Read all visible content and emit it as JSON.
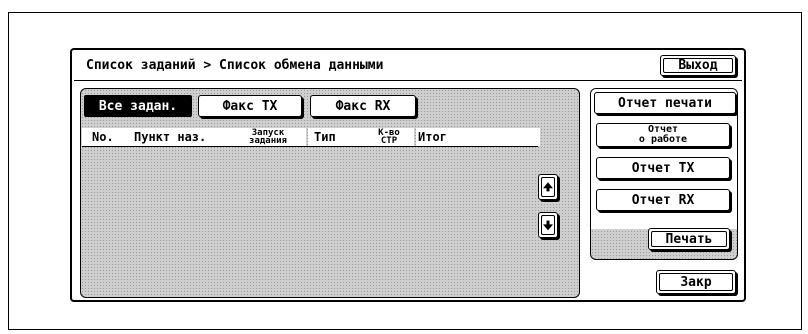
{
  "header": {
    "title": "Список заданий > Список обмена данными",
    "exit_label": "Выход"
  },
  "filter_tabs": [
    {
      "label": "Все задан.",
      "selected": true
    },
    {
      "label": "Факс TX",
      "selected": false
    },
    {
      "label": "Факс RX",
      "selected": false
    }
  ],
  "columns": {
    "no": "No.",
    "destination": "Пункт наз.",
    "start_line1": "Запуск",
    "start_line2": "задания",
    "type": "Тип",
    "pages_line1": "К-во",
    "pages_line2": "СТР",
    "result": "Итог"
  },
  "rows": [],
  "scroll": {
    "up_icon": "arrow-up-icon",
    "down_icon": "arrow-down-icon"
  },
  "reports": {
    "heading": "Отчет печати",
    "work_line1": "Отчет",
    "work_line2": "о работе",
    "tx_label": "Отчет TX",
    "rx_label": "Отчет RX",
    "print_label": "Печать"
  },
  "close_label": "Закр",
  "colors": {
    "pattern": "#cfcfcf",
    "selected_bg": "#000000",
    "selected_text": "#ffffff"
  }
}
